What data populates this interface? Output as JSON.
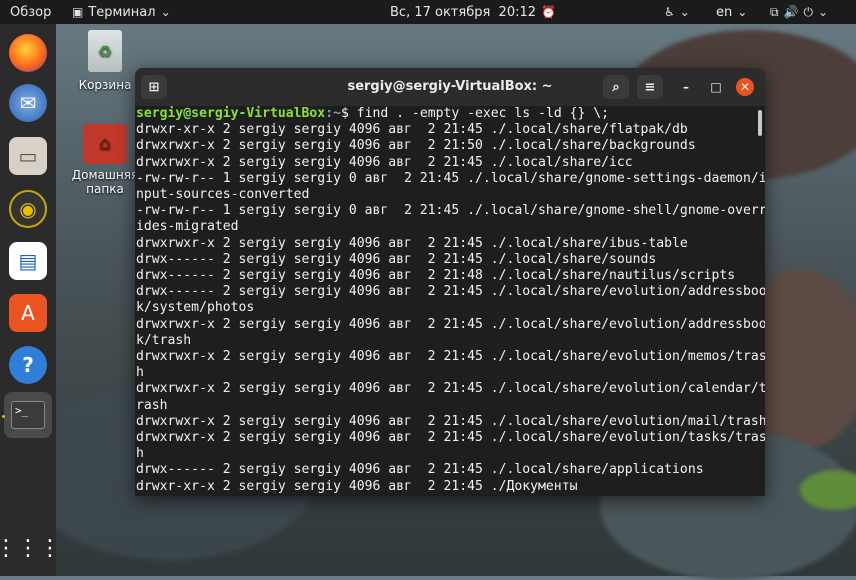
{
  "topbar": {
    "overview": "Обзор",
    "app_name": "Терминал",
    "clock": "Вс, 17 октября  20:12",
    "lang": "en"
  },
  "desktop": {
    "trash_label": "Корзина",
    "home_label": "Домашняя папка"
  },
  "terminal": {
    "title": "sergiy@sergiy-VirtualBox: ~",
    "prompt_user": "sergiy@sergiy-VirtualBox",
    "prompt_path": ":~",
    "command": "$ find . -empty -exec ls -ld {} \\;",
    "output": [
      "drwxr-xr-x 2 sergiy sergiy 4096 авг  2 21:45 ./.local/share/flatpak/db",
      "drwxrwxr-x 2 sergiy sergiy 4096 авг  2 21:50 ./.local/share/backgrounds",
      "drwxrwxr-x 2 sergiy sergiy 4096 авг  2 21:45 ./.local/share/icc",
      "-rw-rw-r-- 1 sergiy sergiy 0 авг  2 21:45 ./.local/share/gnome-settings-daemon/i",
      "nput-sources-converted",
      "-rw-rw-r-- 1 sergiy sergiy 0 авг  2 21:45 ./.local/share/gnome-shell/gnome-overr",
      "ides-migrated",
      "drwxrwxr-x 2 sergiy sergiy 4096 авг  2 21:45 ./.local/share/ibus-table",
      "drwx------ 2 sergiy sergiy 4096 авг  2 21:45 ./.local/share/sounds",
      "drwx------ 2 sergiy sergiy 4096 авг  2 21:48 ./.local/share/nautilus/scripts",
      "drwx------ 2 sergiy sergiy 4096 авг  2 21:45 ./.local/share/evolution/addressboo",
      "k/system/photos",
      "drwxrwxr-x 2 sergiy sergiy 4096 авг  2 21:45 ./.local/share/evolution/addressboo",
      "k/trash",
      "drwxrwxr-x 2 sergiy sergiy 4096 авг  2 21:45 ./.local/share/evolution/memos/tras",
      "h",
      "drwxrwxr-x 2 sergiy sergiy 4096 авг  2 21:45 ./.local/share/evolution/calendar/t",
      "rash",
      "drwxrwxr-x 2 sergiy sergiy 4096 авг  2 21:45 ./.local/share/evolution/mail/trash",
      "drwxrwxr-x 2 sergiy sergiy 4096 авг  2 21:45 ./.local/share/evolution/tasks/tras",
      "h",
      "drwx------ 2 sergiy sergiy 4096 авг  2 21:45 ./.local/share/applications",
      "drwxr-xr-x 2 sergiy sergiy 4096 авг  2 21:45 ./Документы"
    ]
  },
  "dock": {
    "icons": [
      "firefox-icon",
      "thunderbird-icon",
      "files-icon",
      "rhythmbox-icon",
      "writer-icon",
      "software-icon",
      "help-icon",
      "terminal-icon"
    ],
    "apps_grid_icon": "apps-grid-icon"
  },
  "colors": {
    "accent": "#e95420",
    "prompt_user": "#8ae234",
    "prompt_path": "#729fcf"
  }
}
